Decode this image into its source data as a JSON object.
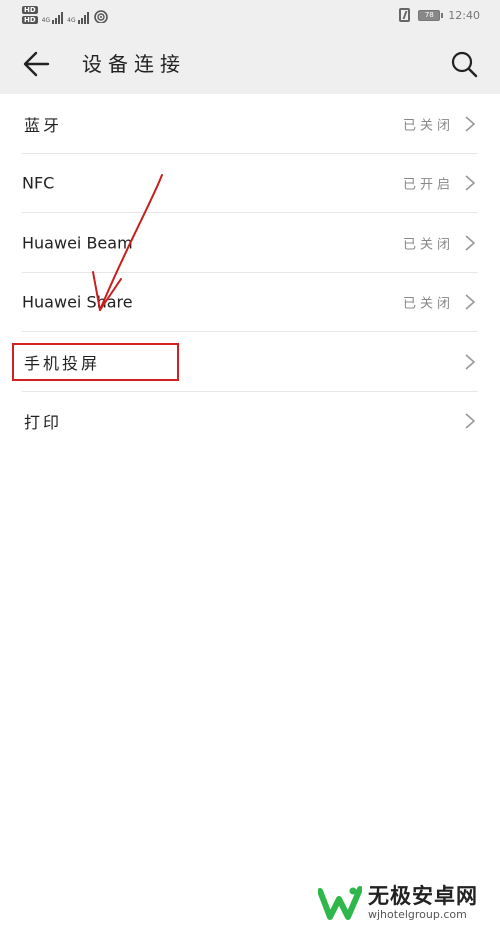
{
  "status_bar": {
    "hd_badge": "HD",
    "net_1": "4G",
    "net_2": "4G",
    "battery": "78",
    "time": "12:40"
  },
  "header": {
    "title": "设备连接",
    "back_icon": "arrow-left-icon",
    "search_icon": "search-icon"
  },
  "items": [
    {
      "label": "蓝牙",
      "status": "已关闭"
    },
    {
      "label": "NFC",
      "status": "已开启"
    },
    {
      "label": "Huawei Beam",
      "status": "已关闭"
    },
    {
      "label": "Huawei Share",
      "status": "已关闭"
    },
    {
      "label": "手机投屏",
      "status": ""
    },
    {
      "label": "打印",
      "status": ""
    }
  ],
  "annotation": {
    "box_color": "#d21f1f",
    "arrow_color": "#c81e1e"
  },
  "watermark": {
    "title": "无极安卓网",
    "url": "wjhotelgroup.com",
    "logo_color": "#2eb84b"
  }
}
